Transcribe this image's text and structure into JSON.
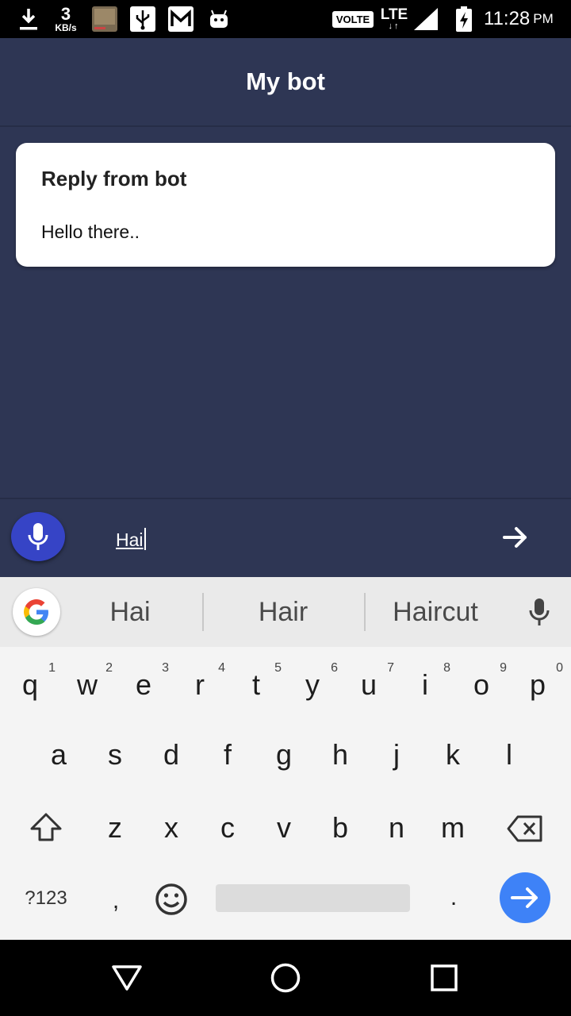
{
  "status_bar": {
    "net_speed_value": "3",
    "net_speed_unit": "KB/s",
    "volte": "VOLTE",
    "lte": "LTE",
    "lte_arrows": "↓↑",
    "time": "11:28",
    "ampm": "PM"
  },
  "app": {
    "title": "My bot",
    "background_color": "#2e3654"
  },
  "bot_card": {
    "title": "Reply from bot",
    "message": "Hello there.."
  },
  "input_bar": {
    "value": "Hai",
    "mic_color": "#3644c6"
  },
  "keyboard": {
    "suggestions": [
      "Hai",
      "Hair",
      "Haircut"
    ],
    "row1": [
      {
        "key": "q",
        "hint": "1"
      },
      {
        "key": "w",
        "hint": "2"
      },
      {
        "key": "e",
        "hint": "3"
      },
      {
        "key": "r",
        "hint": "4"
      },
      {
        "key": "t",
        "hint": "5"
      },
      {
        "key": "y",
        "hint": "6"
      },
      {
        "key": "u",
        "hint": "7"
      },
      {
        "key": "i",
        "hint": "8"
      },
      {
        "key": "o",
        "hint": "9"
      },
      {
        "key": "p",
        "hint": "0"
      }
    ],
    "row2": [
      "a",
      "s",
      "d",
      "f",
      "g",
      "h",
      "j",
      "k",
      "l"
    ],
    "row3": [
      "z",
      "x",
      "c",
      "v",
      "b",
      "n",
      "m"
    ],
    "symbols_label": "?123",
    "comma": ",",
    "period": ".",
    "enter_color": "#3e82f7"
  }
}
